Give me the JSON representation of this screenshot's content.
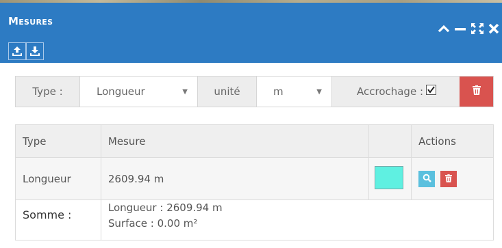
{
  "panel": {
    "title": "Mesures",
    "icons": {
      "import": "upload-icon",
      "export": "download-icon",
      "collapse": "chevron-up-icon",
      "minimize": "minus-icon",
      "fullscreen": "expand-icon",
      "close": "close-icon"
    },
    "header_color": "#2d7bc3"
  },
  "toolbar": {
    "type_label": "Type :",
    "type_value": "Longueur",
    "unit_label": "unité",
    "unit_value": "m",
    "snap_label": "Accrochage :",
    "snap_checked": true,
    "delete_color": "#d9534f"
  },
  "table": {
    "headers": [
      "Type",
      "Mesure",
      "",
      "Actions"
    ],
    "rows": [
      {
        "type": "Longueur",
        "mesure": "2609.94 m",
        "color": "#5ff0e1",
        "actions": [
          "search-icon",
          "trash-icon"
        ]
      }
    ],
    "summary": {
      "label": "Somme :",
      "length": "Longueur : 2609.94 m",
      "surface": "Surface : 0.00 m²"
    }
  }
}
